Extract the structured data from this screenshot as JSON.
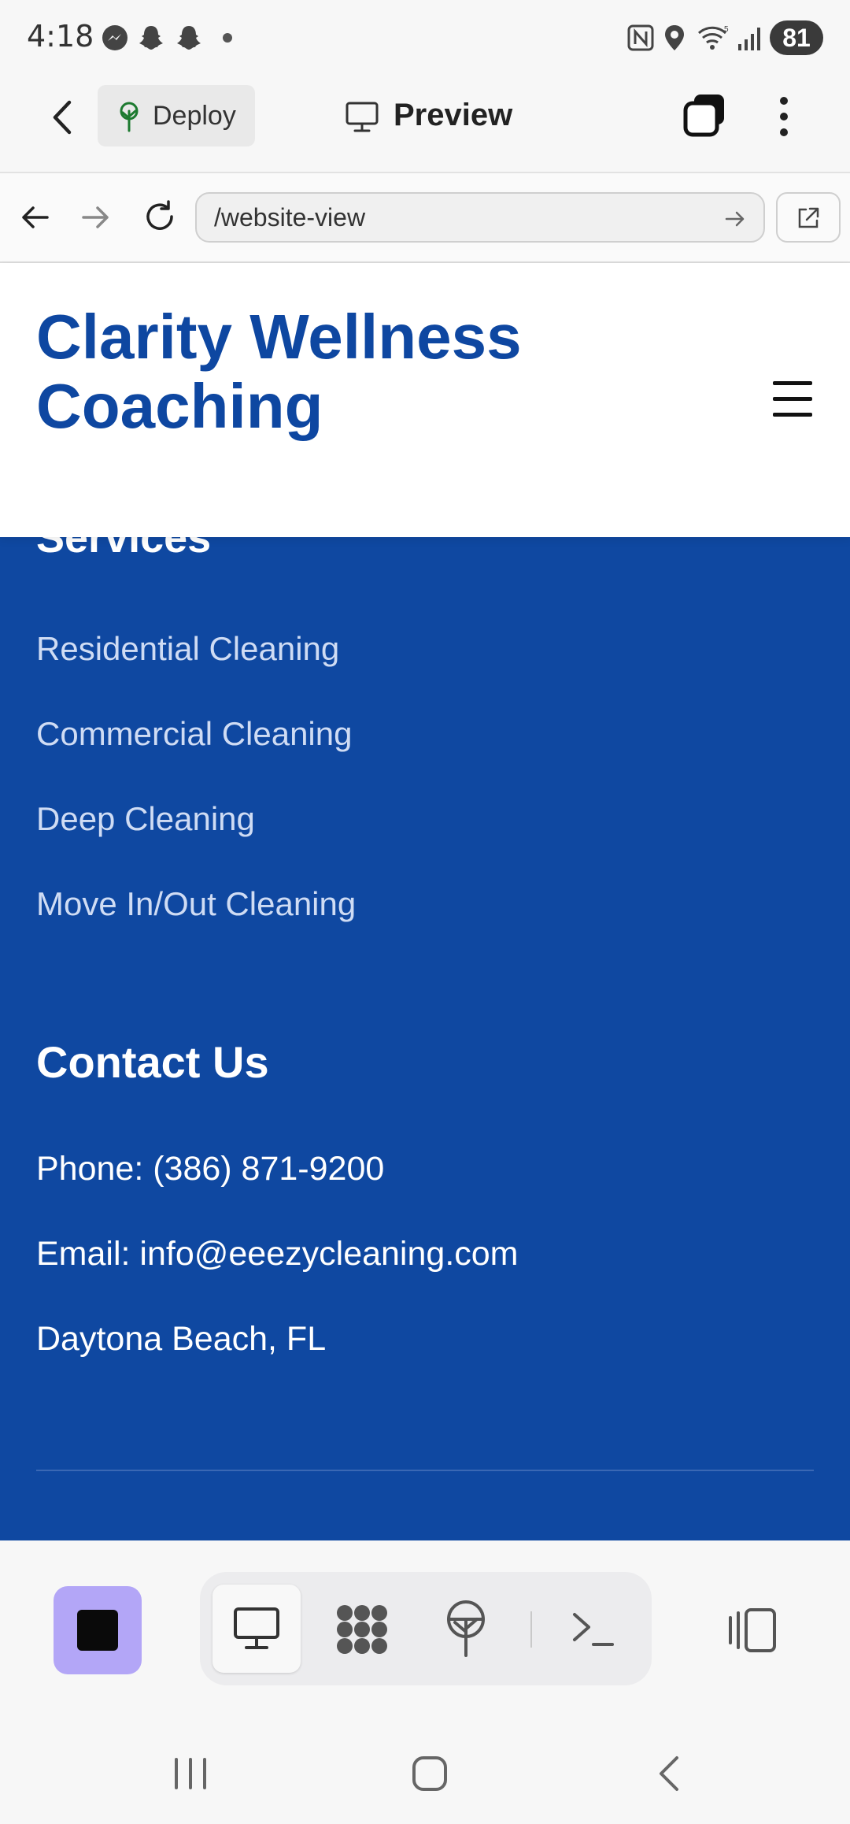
{
  "status_bar": {
    "time": "4:18",
    "battery": "81",
    "icons": [
      "messenger-icon",
      "snapchat-icon",
      "snapchat-icon",
      "dot-icon",
      "nfc-icon",
      "location-icon",
      "wifi-icon",
      "signal-icon"
    ]
  },
  "app_header": {
    "deploy_label": "Deploy",
    "preview_label": "Preview"
  },
  "browser": {
    "url": "/website-view"
  },
  "site": {
    "title": "Clarity Wellness Coaching",
    "services_heading": "Services",
    "services": [
      "Residential Cleaning",
      "Commercial Cleaning",
      "Deep Cleaning",
      "Move In/Out Cleaning"
    ],
    "contact_heading": "Contact Us",
    "contact": {
      "phone": "Phone: (386) 871-9200",
      "email": "Email: info@eeezycleaning.com",
      "location": "Daytona Beach, FL"
    }
  },
  "colors": {
    "brand_blue": "#0f48a1",
    "title_blue": "#0e47a1",
    "stop_button": "#b3a6f7"
  }
}
